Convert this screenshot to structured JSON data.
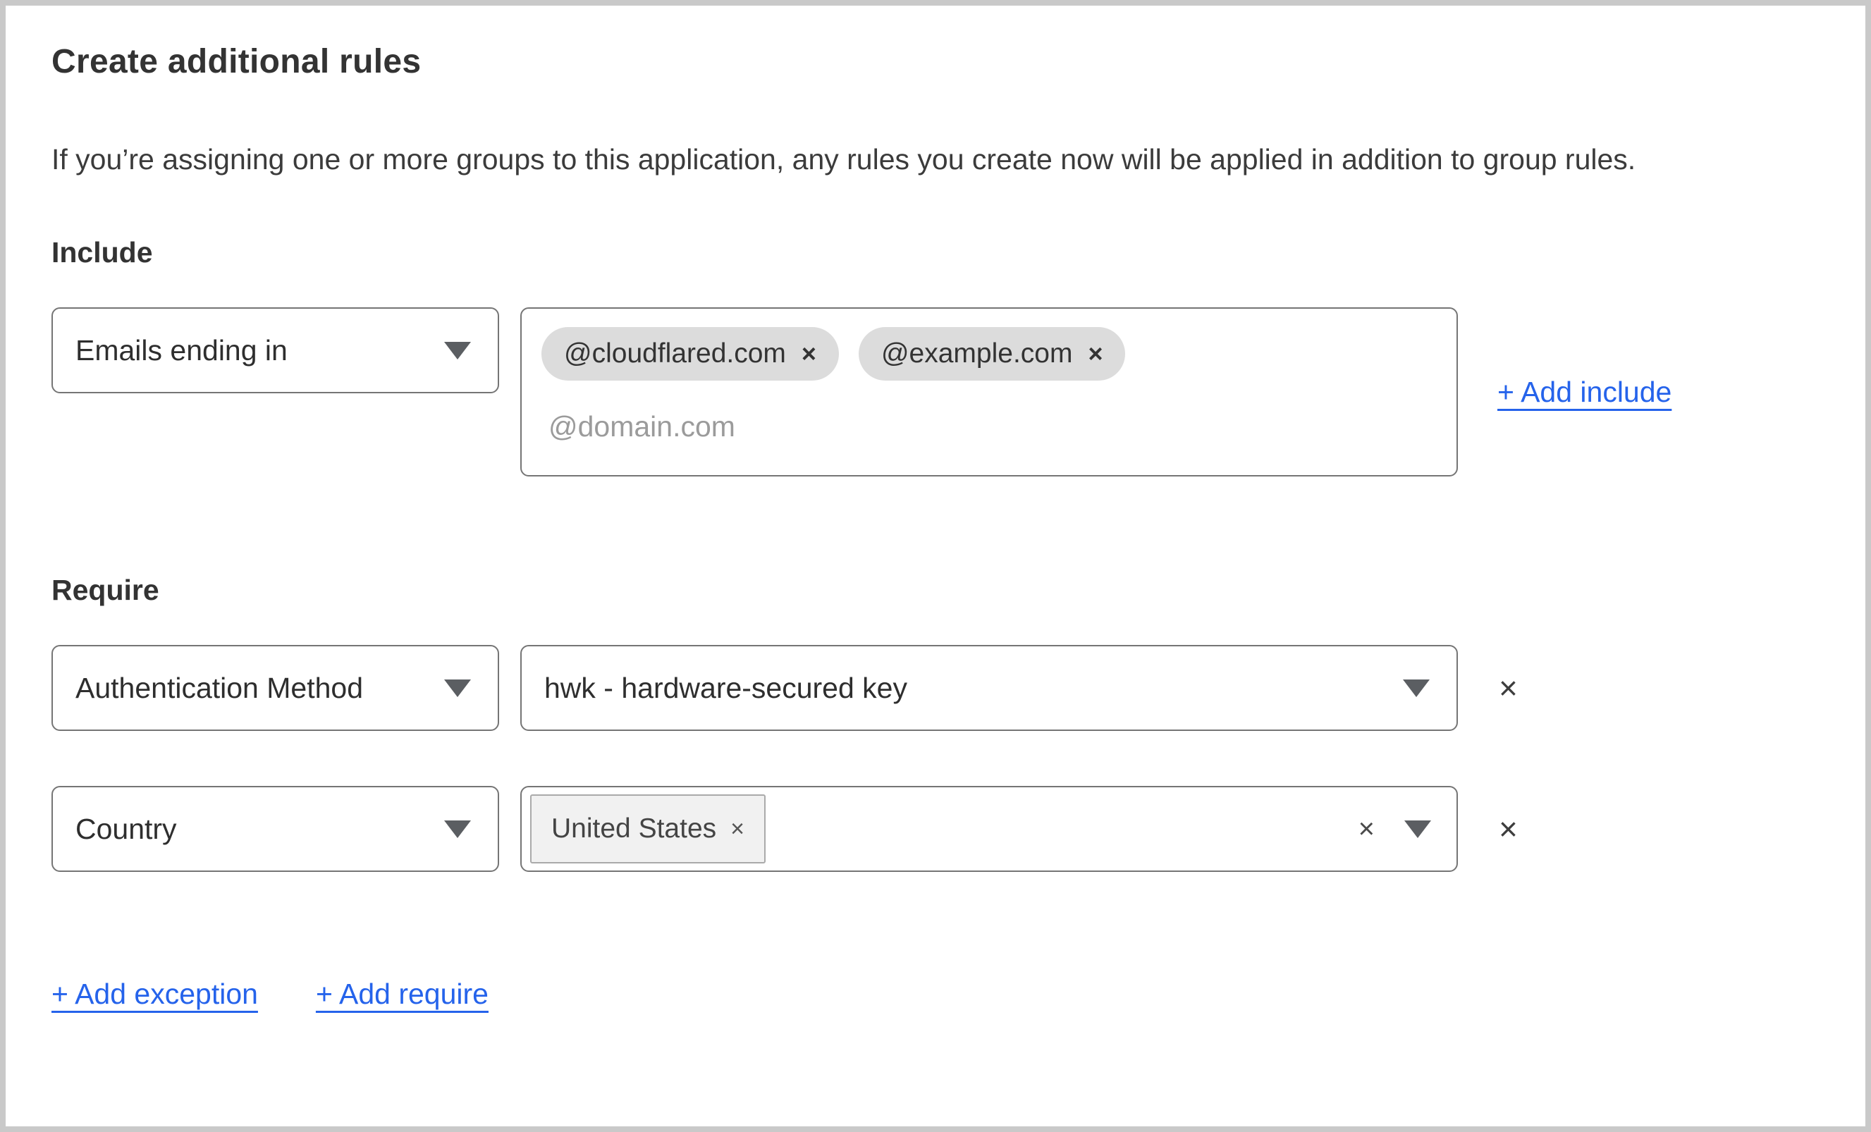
{
  "page": {
    "title": "Create additional rules",
    "description": "If you’re assigning one or more groups to this application, any rules you create now will be applied in addition to group rules."
  },
  "include": {
    "label": "Include",
    "selector_value": "Emails ending in",
    "tags": [
      "@cloudflared.com",
      "@example.com"
    ],
    "placeholder": "@domain.com",
    "add_link": "+ Add include"
  },
  "require": {
    "label": "Require",
    "rules": [
      {
        "selector_value": "Authentication Method",
        "value": "hwk - hardware-secured key"
      },
      {
        "selector_value": "Country",
        "tags": [
          "United States"
        ]
      }
    ]
  },
  "footer": {
    "add_exception": "+ Add exception",
    "add_require": "+ Add require"
  },
  "icons": {
    "tag_remove": "×",
    "clear": "×",
    "remove_rule": "×"
  },
  "colors": {
    "link_blue": "#2563eb",
    "input_border": "#757575",
    "pill_gray": "#dcdcdc",
    "country_tag_bg": "#f1f1f1",
    "country_tag_border": "#aaaaaa",
    "placeholder_gray": "#9b9b9b",
    "text_dark": "#333333",
    "frame_border": "#c9c9c9"
  }
}
